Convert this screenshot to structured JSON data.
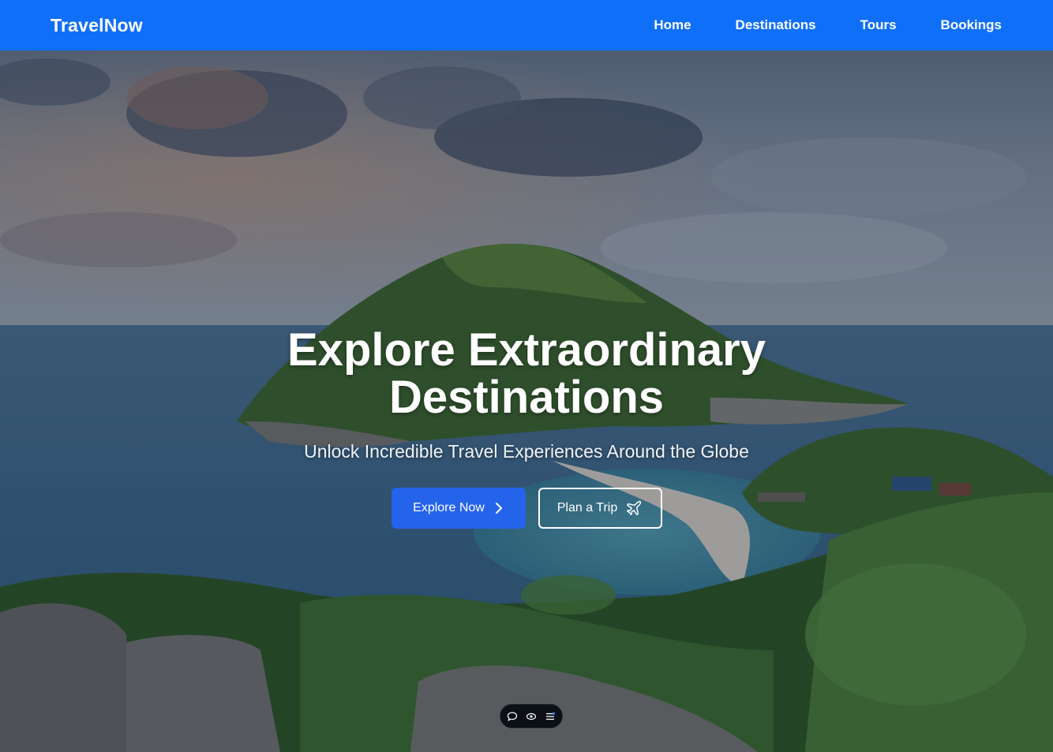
{
  "nav": {
    "brand": "TravelNow",
    "links": [
      "Home",
      "Destinations",
      "Tours",
      "Bookings"
    ]
  },
  "hero": {
    "headline": "Explore Extraordinary Destinations",
    "subline": "Unlock Incredible Travel Experiences Around the Globe",
    "primary_cta": "Explore Now",
    "secondary_cta": "Plan a Trip"
  },
  "icons": {
    "primary_cta_icon": "chevron-right-icon",
    "secondary_cta_icon": "airplane-icon",
    "toolbar": [
      "chat-icon",
      "eye-icon",
      "list-icon"
    ]
  },
  "colors": {
    "navbar": "#106ff8",
    "primary_button": "#2563eb",
    "text": "#ffffff"
  }
}
